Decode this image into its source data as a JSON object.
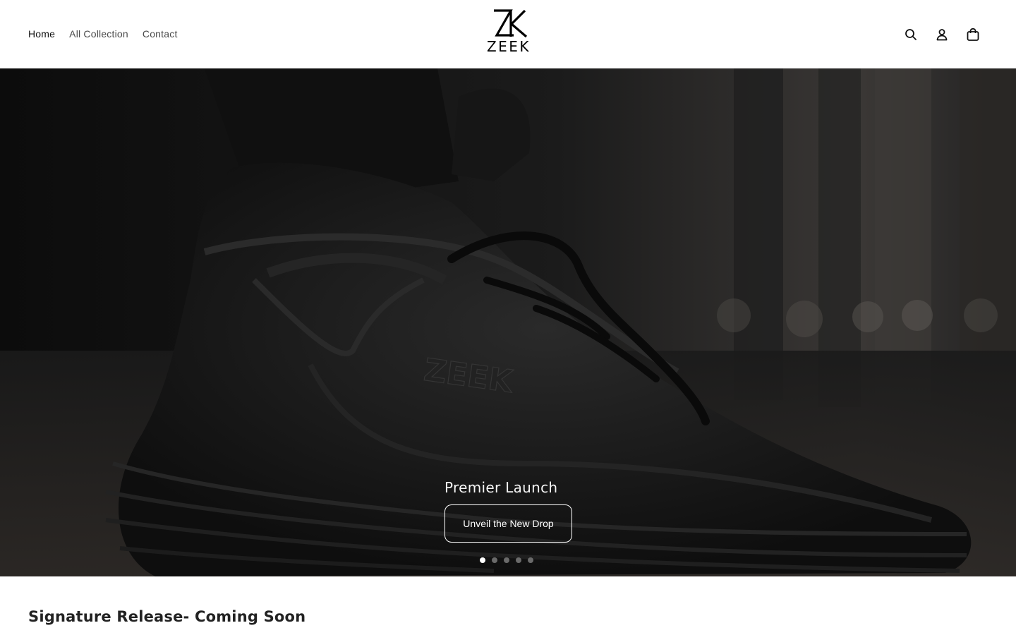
{
  "header": {
    "nav": [
      {
        "label": "Home",
        "active": true
      },
      {
        "label": "All Collection",
        "active": false
      },
      {
        "label": "Contact",
        "active": false
      }
    ],
    "logo_text": "ZEEK",
    "icons": [
      "search-icon",
      "account-icon",
      "cart-icon"
    ]
  },
  "hero": {
    "title": "Premier Launch",
    "button_label": "Unveil the New Drop",
    "slide_count": 5,
    "active_slide": 1,
    "shoe_logo_text": "ZEEK"
  },
  "section": {
    "title": "Signature Release- Coming Soon"
  },
  "colors": {
    "background": "#ffffff",
    "hero_dark": "#151515",
    "text": "#1a1a1a"
  }
}
